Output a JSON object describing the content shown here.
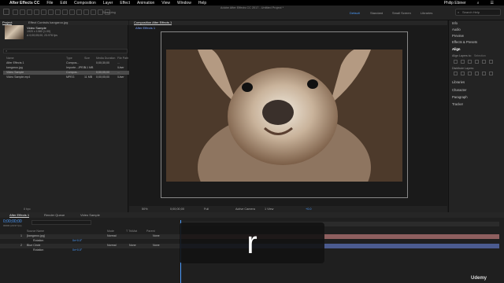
{
  "macmenu": {
    "items": [
      "After Effects CC",
      "File",
      "Edit",
      "Composition",
      "Layer",
      "Effect",
      "Animation",
      "View",
      "Window",
      "Help"
    ],
    "window_title": "Adobe After Effects CC 2017 - Untitled Project *",
    "user": "Philip Ebiner"
  },
  "toolbar": {
    "snap": "Snapping",
    "workspaces": [
      "Default",
      "Standard",
      "Small Screen",
      "Libraries"
    ],
    "search": "Search Help"
  },
  "project": {
    "tab": "Project",
    "effects_tab": "Effect Controls kangaroo.jpg",
    "item_name": "Video Sample",
    "item_meta": "1920 x 1080 (1.00)",
    "item_meta2": "Δ 0;00;05;00, 23.976 fps",
    "columns": [
      "Name",
      "Type",
      "Size",
      "Media Duration",
      "File Path"
    ],
    "items": [
      {
        "name": "After Effects 1",
        "type": "Compos...",
        "size": "",
        "dur": "0;00;30;00",
        "path": "..."
      },
      {
        "name": "kangaroo.jpg",
        "type": "Importe...JPEG",
        "size": "5.1 MB",
        "dur": "",
        "path": "/User"
      },
      {
        "name": "Video Sample",
        "type": "Compos...",
        "size": "",
        "dur": "0;00;05;00",
        "path": "..."
      },
      {
        "name": "Video Sample.mp4",
        "type": "MPEG",
        "size": "11 MB",
        "dur": "0;00;05;00",
        "path": "/User"
      }
    ],
    "bpc": "8 bpc"
  },
  "viewer": {
    "tab": "Composition After Effects 1",
    "sub_tab": "After Effects 1",
    "zoom": "50%",
    "timecode": "0;00;00;00",
    "res": "Full",
    "camera": "Active Camera",
    "views": "1 View",
    "exposure": "+0.0"
  },
  "rightpanel": {
    "items": [
      "Info",
      "Audio",
      "Preview",
      "Effects & Presets",
      "Align",
      "Libraries",
      "Character",
      "Paragraph",
      "Tracker"
    ],
    "align_to": "Align Layers to:",
    "selection": "Selection",
    "distribute": "Distribute Layers:"
  },
  "timeline": {
    "tabs": [
      "After Effects 1",
      "Render Queue",
      "Video Sample"
    ],
    "timecode": "0;00;00;00",
    "fps": "00000 (29.97 fps)",
    "columns": [
      "Source Name",
      "Mode",
      "T TrkMat",
      "Parent"
    ],
    "layers": [
      {
        "num": "1",
        "name": "[kangaroo.jpg]",
        "mode": "Normal",
        "parent": "None",
        "prop": "Rotation",
        "val": "0x+0.0°"
      },
      {
        "num": "2",
        "name": "Blue Circle",
        "mode": "Normal",
        "trk": "None",
        "parent": "None",
        "prop": "Rotation",
        "val": "0x+0.0°"
      }
    ]
  },
  "caption": "r",
  "udemy": "Udemy"
}
